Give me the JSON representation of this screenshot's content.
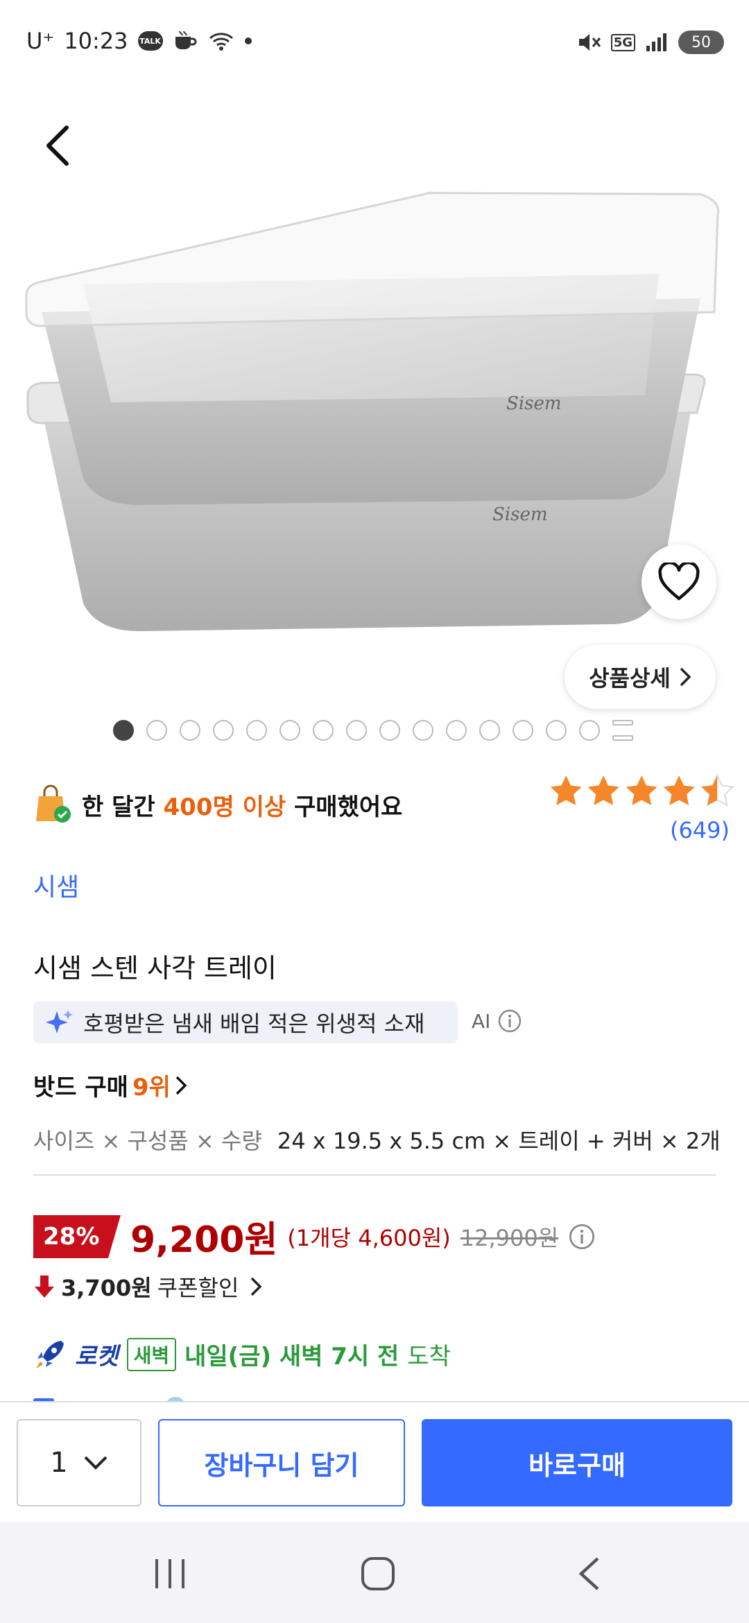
{
  "status_bar": {
    "carrier": "U⁺",
    "time": "10:23",
    "talk_badge": "TALK",
    "network": "5G",
    "battery": "50"
  },
  "product": {
    "image_alt": "Sisem stainless rectangular trays with lids",
    "logo_text": "Sisem",
    "detail_button": "상품상세",
    "page_count": 15,
    "active_page": 1
  },
  "social_proof": {
    "prefix": "한 달간 ",
    "highlight": "400명 이상",
    "suffix": " 구매했어요"
  },
  "rating": {
    "stars": 4.5,
    "review_count": "(649)"
  },
  "brand": "시샘",
  "title": "시샘 스텐 사각 트레이",
  "ai_summary": {
    "text": "호평받은 냄새 배임 적은 위생적 소재",
    "label": "AI"
  },
  "rank": {
    "prefix": "밧드 구매 ",
    "value": "9위"
  },
  "option": {
    "label": "사이즈 × 구성품 × 수량",
    "value": "24 x 19.5 x 5.5 cm × 트레이 + 커버 × 2개"
  },
  "price": {
    "discount": "28%",
    "sale": "9,200원",
    "unit": "(1개당 4,600원)",
    "original": "12,900원"
  },
  "coupon": {
    "amount": "3,700원",
    "label": "쿠폰할인"
  },
  "delivery": {
    "rocket": "로켓",
    "dawn": "새벽",
    "arrival": "내일(금) 새벽 7시 전",
    "arrival_suffix": "도착"
  },
  "action_bar": {
    "quantity": "1",
    "cart_label": "장바구니 담기",
    "buy_label": "바로구매"
  },
  "colors": {
    "accent": "#346aff",
    "price_red": "#ae0000",
    "orange": "#e8600c",
    "green": "#2a9a3a",
    "star": "#f5872a"
  }
}
